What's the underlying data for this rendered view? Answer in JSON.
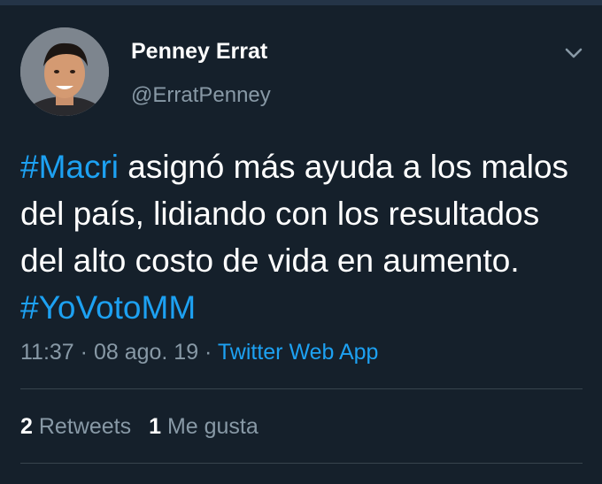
{
  "tweet": {
    "author": {
      "display_name": "Penney Errat",
      "handle": "@ErratPenney"
    },
    "text_segments": [
      {
        "type": "hashtag",
        "text": "#Macri"
      },
      {
        "type": "text",
        "text": " asignó más ayuda a los malos del país, lidiando con los resultados del alto costo de vida en aumento. "
      },
      {
        "type": "hashtag",
        "text": "#YoVotoMM"
      }
    ],
    "time": "11:37",
    "separator": " · ",
    "date": "08 ago. 19",
    "source": "Twitter Web App",
    "retweets_count": "2",
    "retweets_label": "Retweets",
    "likes_count": "1",
    "likes_label": "Me gusta"
  },
  "icons": {
    "menu_caret": "chevron-down-icon",
    "avatar": "profile-photo"
  },
  "colors": {
    "background": "#15202b",
    "text": "#ffffff",
    "secondary_text": "#8899a6",
    "link": "#1da1f2",
    "divider": "#38444d"
  }
}
